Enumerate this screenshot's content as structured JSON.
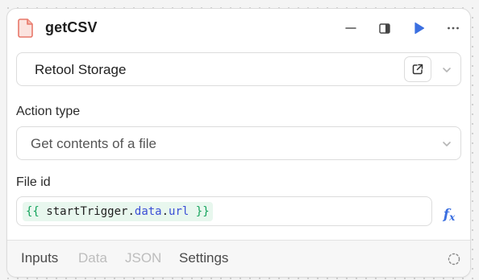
{
  "block": {
    "title": "getCSV",
    "icon": "file-icon",
    "header_actions": [
      "minimize-icon",
      "side-panel-icon",
      "play-icon",
      "more-icon"
    ]
  },
  "resource": {
    "label": "Retool Storage",
    "actions": [
      "external-link-icon",
      "chevron-down-icon"
    ]
  },
  "action_type": {
    "label": "Action type",
    "value": "Get contents of a file"
  },
  "file_id": {
    "label": "File id",
    "code": {
      "open": "{{",
      "ident": "startTrigger",
      "dot1": ".",
      "prop1": "data",
      "dot2": ".",
      "prop2": "url",
      "close": "}}"
    },
    "fx_label": "f",
    "fx_sub": "x"
  },
  "tabs": [
    {
      "label": "Inputs",
      "state": "active"
    },
    {
      "label": "Data",
      "state": "disabled"
    },
    {
      "label": "JSON",
      "state": "disabled"
    },
    {
      "label": "Settings",
      "state": "active"
    }
  ],
  "colors": {
    "run_accent": "#3b6fe0",
    "file_icon": "#e8786a",
    "code_brace": "#14a35c",
    "code_prop": "#3b4fd6"
  }
}
